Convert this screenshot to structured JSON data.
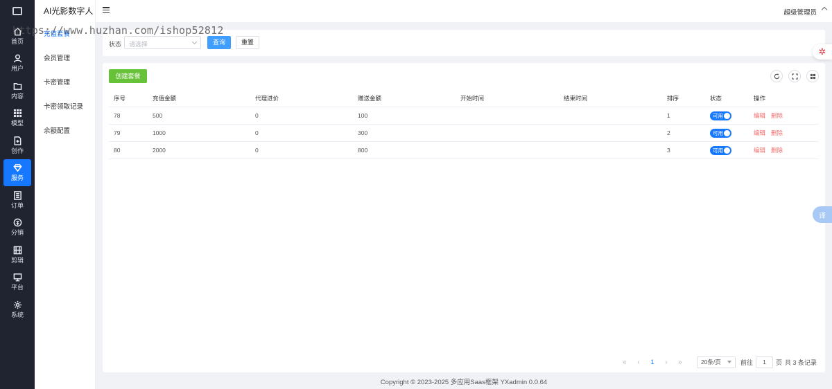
{
  "app": {
    "title": "AI光影数字人"
  },
  "watermark": "https://www.huzhan.com/ishop52812",
  "rail": [
    {
      "label": "首页",
      "icon": "home-icon"
    },
    {
      "label": "用户",
      "icon": "user-icon"
    },
    {
      "label": "内容",
      "icon": "folder-icon"
    },
    {
      "label": "模型",
      "icon": "grid-icon"
    },
    {
      "label": "创作",
      "icon": "document-plus-icon"
    },
    {
      "label": "服务",
      "icon": "diamond-icon",
      "active": true
    },
    {
      "label": "订单",
      "icon": "list-icon"
    },
    {
      "label": "分销",
      "icon": "exchange-icon"
    },
    {
      "label": "剪辑",
      "icon": "film-icon"
    },
    {
      "label": "平台",
      "icon": "monitor-icon"
    },
    {
      "label": "系统",
      "icon": "gear-icon"
    }
  ],
  "submenu": [
    {
      "label": "充值套餐",
      "active": true
    },
    {
      "label": "会员管理"
    },
    {
      "label": "卡密管理"
    },
    {
      "label": "卡密领取记录"
    },
    {
      "label": "余额配置"
    }
  ],
  "header": {
    "user": "超级管理员"
  },
  "filter": {
    "status_label": "状态",
    "status_placeholder": "请选择",
    "query_label": "查询",
    "reset_label": "重置"
  },
  "toolbar": {
    "create_label": "创建套餐"
  },
  "table": {
    "columns": [
      "序号",
      "充值金额",
      "代理进价",
      "赠送金额",
      "开始时间",
      "结束时间",
      "排序",
      "状态",
      "操作"
    ],
    "rows": [
      {
        "id": "78",
        "amount": "500",
        "agent_price": "0",
        "bonus": "100",
        "start": "",
        "end": "",
        "sort": "1",
        "status": "可用"
      },
      {
        "id": "79",
        "amount": "1000",
        "agent_price": "0",
        "bonus": "300",
        "start": "",
        "end": "",
        "sort": "2",
        "status": "可用"
      },
      {
        "id": "80",
        "amount": "2000",
        "agent_price": "0",
        "bonus": "800",
        "start": "",
        "end": "",
        "sort": "3",
        "status": "可用"
      }
    ],
    "edit_label": "编辑",
    "delete_label": "删除"
  },
  "pager": {
    "current_page": "1",
    "page_size": "20条/页",
    "goto_label": "前往",
    "goto_value": "1",
    "page_unit": "页",
    "total": "共 3 条记录"
  },
  "footer": "Copyright © 2023-2025 多应用Saas框架  YXadmin 0.0.64",
  "colors": {
    "primary": "#1677ff",
    "success": "#67c23a",
    "danger": "#f56c6c",
    "rail_bg": "#1f2430"
  }
}
